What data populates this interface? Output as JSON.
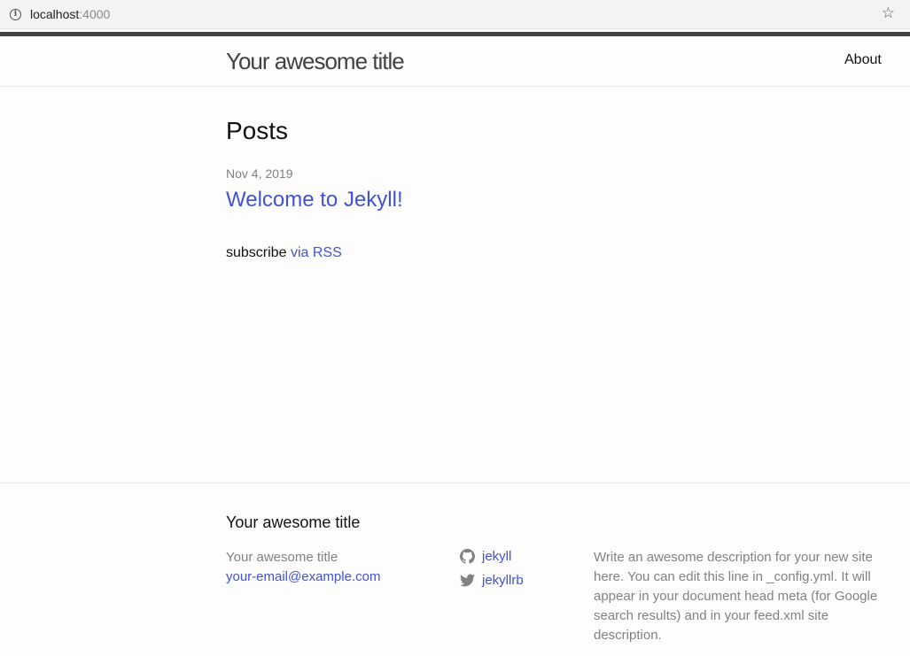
{
  "browser": {
    "url_host": "localhost",
    "url_port": ":4000"
  },
  "header": {
    "site_title": "Your awesome title",
    "nav_about": "About"
  },
  "main": {
    "heading": "Posts",
    "posts": [
      {
        "date": "Nov 4, 2019",
        "title": "Welcome to Jekyll!"
      }
    ],
    "subscribe_text": "subscribe",
    "subscribe_link": "via RSS"
  },
  "footer": {
    "heading": "Your awesome title",
    "name": "Your awesome title",
    "email": "your-email@example.com",
    "social": [
      {
        "icon": "github-icon",
        "label": "jekyll"
      },
      {
        "icon": "twitter-icon",
        "label": "jekyllrb"
      }
    ],
    "description": "Write an awesome description for your new site here. You can edit this line in _config.yml. It will appear in your document head meta (for Google search results) and in your feed.xml site description."
  },
  "colors": {
    "link": "#4153d4",
    "meta_text": "#828282",
    "header_bar": "#424242"
  }
}
